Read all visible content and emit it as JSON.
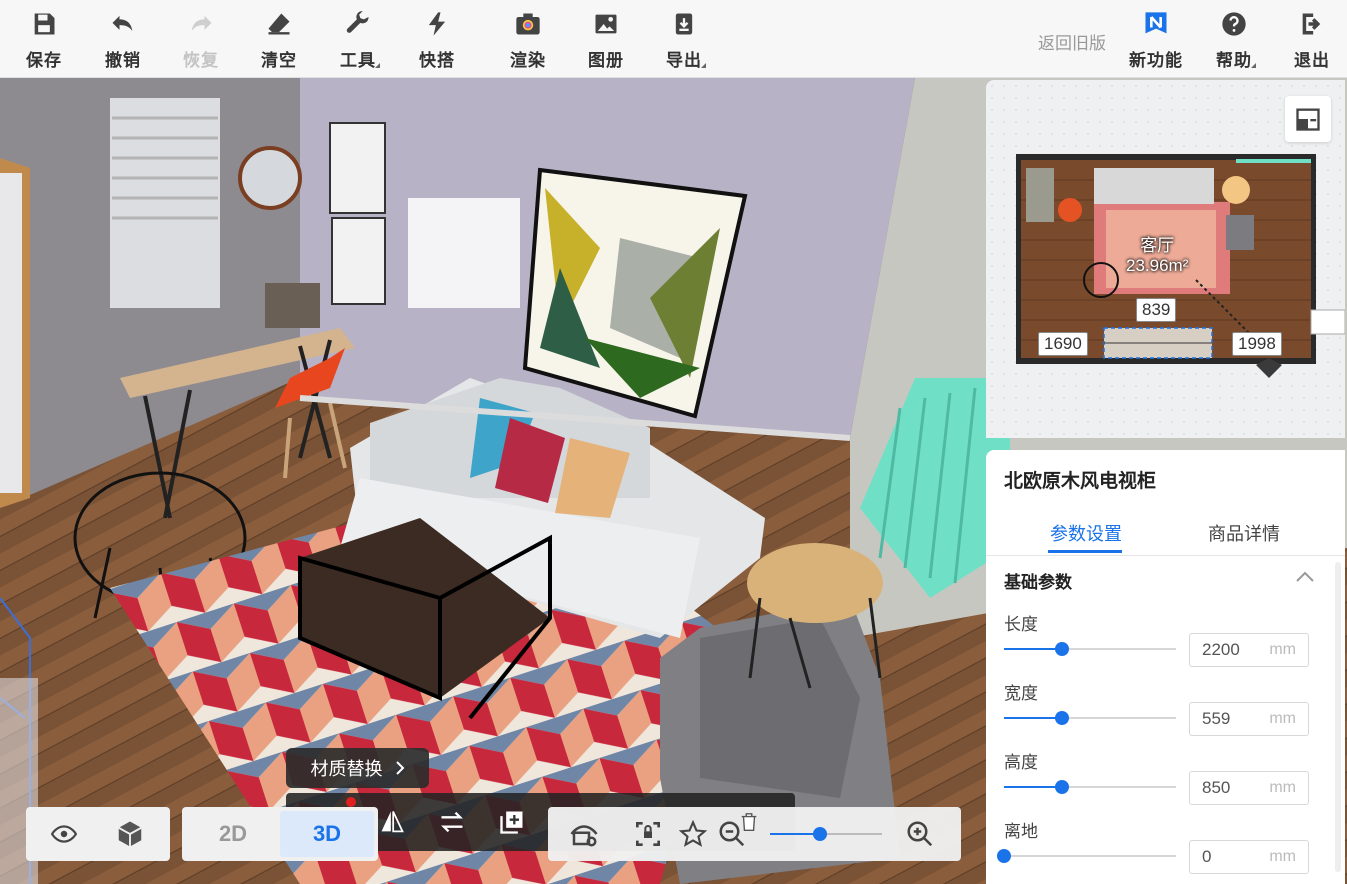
{
  "toolbar": {
    "items": [
      {
        "label": "保存",
        "icon": "save-icon"
      },
      {
        "label": "撤销",
        "icon": "undo-icon"
      },
      {
        "label": "恢复",
        "icon": "redo-icon"
      },
      {
        "label": "清空",
        "icon": "eraser-icon"
      },
      {
        "label": "工具",
        "icon": "wrench-icon"
      },
      {
        "label": "快搭",
        "icon": "lightning-icon"
      },
      {
        "label": "渲染",
        "icon": "camera-icon"
      },
      {
        "label": "图册",
        "icon": "image-icon"
      },
      {
        "label": "导出",
        "icon": "export-icon"
      }
    ],
    "legacy": "返回旧版",
    "right_items": [
      {
        "label": "新功能",
        "icon": "new-feature-icon"
      },
      {
        "label": "帮助",
        "icon": "help-icon"
      },
      {
        "label": "退出",
        "icon": "exit-icon"
      }
    ]
  },
  "minimap": {
    "room_name": "客厅",
    "room_area": "23.96m²",
    "dims": {
      "top": "839",
      "left": "1690",
      "right": "1998"
    }
  },
  "props": {
    "title": "北欧原木风电视柜",
    "tabs": [
      "参数设置",
      "商品详情"
    ],
    "section": "基础参数",
    "params": [
      {
        "name": "长度",
        "value": "2200",
        "unit": "mm",
        "level": 0.34
      },
      {
        "name": "宽度",
        "value": "559",
        "unit": "mm",
        "level": 0.34
      },
      {
        "name": "高度",
        "value": "850",
        "unit": "mm",
        "level": 0.34
      },
      {
        "name": "离地",
        "value": "0",
        "unit": "mm",
        "level": 0.0
      }
    ]
  },
  "bottom": {
    "material": "材质替换",
    "mode_2d": "2D",
    "mode_3d": "3D",
    "zoom_level": 0.45
  },
  "colors": {
    "accent": "#1a73e8",
    "wall": "#b8b2c6",
    "floor": "#7a5236",
    "rug_red": "#c8283c",
    "radiator": "#6fe0c6"
  }
}
